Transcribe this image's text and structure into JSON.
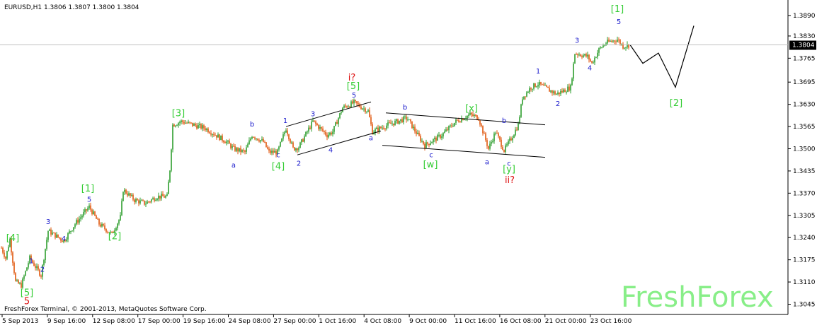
{
  "header": {
    "symbol_label": "EURUSD,H1  1.3806 1.3807 1.3800 1.3804"
  },
  "price_badge": "1.3804",
  "copyright": "FreshForex Terminal, © 2001-2013, MetaQuotes Software Corp.",
  "watermark": "FreshForex",
  "colors": {
    "bull": "#2e9e2e",
    "bear": "#e0560c",
    "wave_green": "#33cc33",
    "wave_blue": "#1a1acc",
    "wave_red": "#dd1111",
    "channel": "#000000",
    "badge_bg": "#000000",
    "watermark": "#88ee88"
  },
  "chart_data": {
    "type": "candlestick",
    "symbol": "EURUSD",
    "timeframe": "H1",
    "ylim": [
      1.3015,
      1.3925
    ],
    "y_ticks": [
      "1.3890",
      "1.3830",
      "1.3765",
      "1.3695",
      "1.3630",
      "1.3565",
      "1.3500",
      "1.3435",
      "1.3370",
      "1.3305",
      "1.3240",
      "1.3175",
      "1.3110",
      "1.3045"
    ],
    "x_ticks": [
      "5 Sep 2013",
      "9 Sep 16:00",
      "12 Sep 08:00",
      "17 Sep 00:00",
      "19 Sep 16:00",
      "24 Sep 08:00",
      "27 Sep 00:00",
      "1 Oct 16:00",
      "4 Oct 08:00",
      "9 Oct 00:00",
      "11 Oct 16:00",
      "16 Oct 08:00",
      "21 Oct 00:00",
      "23 Oct 16:00"
    ],
    "current_price": 1.3804,
    "price_path": [
      [
        0,
        1.322
      ],
      [
        8,
        1.318
      ],
      [
        14,
        1.3235
      ],
      [
        22,
        1.311
      ],
      [
        30,
        1.31
      ],
      [
        42,
        1.318
      ],
      [
        58,
        1.313
      ],
      [
        68,
        1.326
      ],
      [
        90,
        1.323
      ],
      [
        106,
        1.328
      ],
      [
        126,
        1.333
      ],
      [
        140,
        1.328
      ],
      [
        158,
        1.325
      ],
      [
        170,
        1.33
      ],
      [
        174,
        1.338
      ],
      [
        190,
        1.335
      ],
      [
        205,
        1.334
      ],
      [
        222,
        1.336
      ],
      [
        236,
        1.336
      ],
      [
        240,
        1.344
      ],
      [
        244,
        1.357
      ],
      [
        256,
        1.358
      ],
      [
        290,
        1.356
      ],
      [
        320,
        1.352
      ],
      [
        330,
        1.35
      ],
      [
        346,
        1.349
      ],
      [
        356,
        1.354
      ],
      [
        372,
        1.352
      ],
      [
        380,
        1.349
      ],
      [
        392,
        1.349
      ],
      [
        404,
        1.356
      ],
      [
        414,
        1.35
      ],
      [
        422,
        1.3505
      ],
      [
        442,
        1.358
      ],
      [
        462,
        1.354
      ],
      [
        470,
        1.355
      ],
      [
        484,
        1.362
      ],
      [
        500,
        1.3635
      ],
      [
        520,
        1.361
      ],
      [
        526,
        1.355
      ],
      [
        548,
        1.357
      ],
      [
        575,
        1.359
      ],
      [
        590,
        1.354
      ],
      [
        600,
        1.351
      ],
      [
        624,
        1.354
      ],
      [
        644,
        1.358
      ],
      [
        664,
        1.36
      ],
      [
        676,
        1.359
      ],
      [
        690,
        1.35
      ],
      [
        700,
        1.355
      ],
      [
        712,
        1.3495
      ],
      [
        722,
        1.353
      ],
      [
        732,
        1.357
      ],
      [
        738,
        1.365
      ],
      [
        750,
        1.368
      ],
      [
        760,
        1.369
      ],
      [
        786,
        1.366
      ],
      [
        806,
        1.368
      ],
      [
        812,
        1.378
      ],
      [
        830,
        1.377
      ],
      [
        836,
        1.375
      ],
      [
        846,
        1.379
      ],
      [
        856,
        1.381
      ],
      [
        872,
        1.382
      ],
      [
        880,
        1.38
      ],
      [
        890,
        1.3804
      ]
    ],
    "forecast_path": [
      [
        890,
        1.3804
      ],
      [
        908,
        1.375
      ],
      [
        930,
        1.378
      ],
      [
        954,
        1.368
      ],
      [
        980,
        1.386
      ]
    ],
    "channels": [
      {
        "from": [
          404,
          1.3565
        ],
        "to": [
          524,
          1.3637
        ]
      },
      {
        "from": [
          420,
          1.3482
        ],
        "to": [
          538,
          1.3552
        ]
      },
      {
        "from": [
          545,
          1.3605
        ],
        "to": [
          770,
          1.357
        ]
      },
      {
        "from": [
          540,
          1.351
        ],
        "to": [
          770,
          1.3475
        ]
      }
    ],
    "annotations": [
      {
        "text": "[4]",
        "x": 18,
        "y": 1.323,
        "color": "green"
      },
      {
        "text": "1",
        "x": 44,
        "y": 1.3165,
        "color": "blue"
      },
      {
        "text": "2",
        "x": 60,
        "y": 1.314,
        "color": "blue"
      },
      {
        "text": "3",
        "x": 68,
        "y": 1.328,
        "color": "blue"
      },
      {
        "text": "4",
        "x": 90,
        "y": 1.323,
        "color": "blue"
      },
      {
        "text": "[5]",
        "x": 38,
        "y": 1.307,
        "color": "green"
      },
      {
        "text": "5",
        "x": 38,
        "y": 1.3045,
        "color": "red"
      },
      {
        "text": "[1]",
        "x": 124,
        "y": 1.3375,
        "color": "green"
      },
      {
        "text": "5",
        "x": 126,
        "y": 1.3345,
        "color": "blue"
      },
      {
        "text": "[2]",
        "x": 162,
        "y": 1.3235,
        "color": "green"
      },
      {
        "text": "[3]",
        "x": 252,
        "y": 1.3595,
        "color": "green"
      },
      {
        "text": "b",
        "x": 356,
        "y": 1.3565,
        "color": "blue"
      },
      {
        "text": "a",
        "x": 330,
        "y": 1.3445,
        "color": "blue"
      },
      {
        "text": "c",
        "x": 393,
        "y": 1.3475,
        "color": "blue"
      },
      {
        "text": "[4]",
        "x": 393,
        "y": 1.344,
        "color": "green"
      },
      {
        "text": "1",
        "x": 403,
        "y": 1.3575,
        "color": "blue"
      },
      {
        "text": "2",
        "x": 422,
        "y": 1.345,
        "color": "blue"
      },
      {
        "text": "3",
        "x": 442,
        "y": 1.3595,
        "color": "blue"
      },
      {
        "text": "4",
        "x": 467,
        "y": 1.349,
        "color": "blue"
      },
      {
        "text": "i?",
        "x": 497,
        "y": 1.37,
        "color": "red"
      },
      {
        "text": "[5]",
        "x": 499,
        "y": 1.3675,
        "color": "green"
      },
      {
        "text": "5",
        "x": 500,
        "y": 1.365,
        "color": "blue"
      },
      {
        "text": "a",
        "x": 524,
        "y": 1.3525,
        "color": "blue"
      },
      {
        "text": "b",
        "x": 572,
        "y": 1.3615,
        "color": "blue"
      },
      {
        "text": "c",
        "x": 609,
        "y": 1.3475,
        "color": "blue"
      },
      {
        "text": "[w]",
        "x": 608,
        "y": 1.3445,
        "color": "green"
      },
      {
        "text": "[x]",
        "x": 666,
        "y": 1.361,
        "color": "green"
      },
      {
        "text": "a",
        "x": 688,
        "y": 1.3455,
        "color": "blue"
      },
      {
        "text": "b",
        "x": 712,
        "y": 1.3575,
        "color": "blue"
      },
      {
        "text": "c",
        "x": 719,
        "y": 1.345,
        "color": "blue"
      },
      {
        "text": "[y]",
        "x": 719,
        "y": 1.3432,
        "color": "green"
      },
      {
        "text": "ii?",
        "x": 720,
        "y": 1.34,
        "color": "red"
      },
      {
        "text": "1",
        "x": 760,
        "y": 1.372,
        "color": "blue"
      },
      {
        "text": "2",
        "x": 788,
        "y": 1.3625,
        "color": "blue"
      },
      {
        "text": "3",
        "x": 815,
        "y": 1.381,
        "color": "blue"
      },
      {
        "text": "4",
        "x": 833,
        "y": 1.373,
        "color": "blue"
      },
      {
        "text": "[1]",
        "x": 872,
        "y": 1.39,
        "color": "green"
      },
      {
        "text": "5",
        "x": 874,
        "y": 1.3865,
        "color": "blue"
      },
      {
        "text": "[2]",
        "x": 955,
        "y": 1.3625,
        "color": "green"
      }
    ]
  }
}
